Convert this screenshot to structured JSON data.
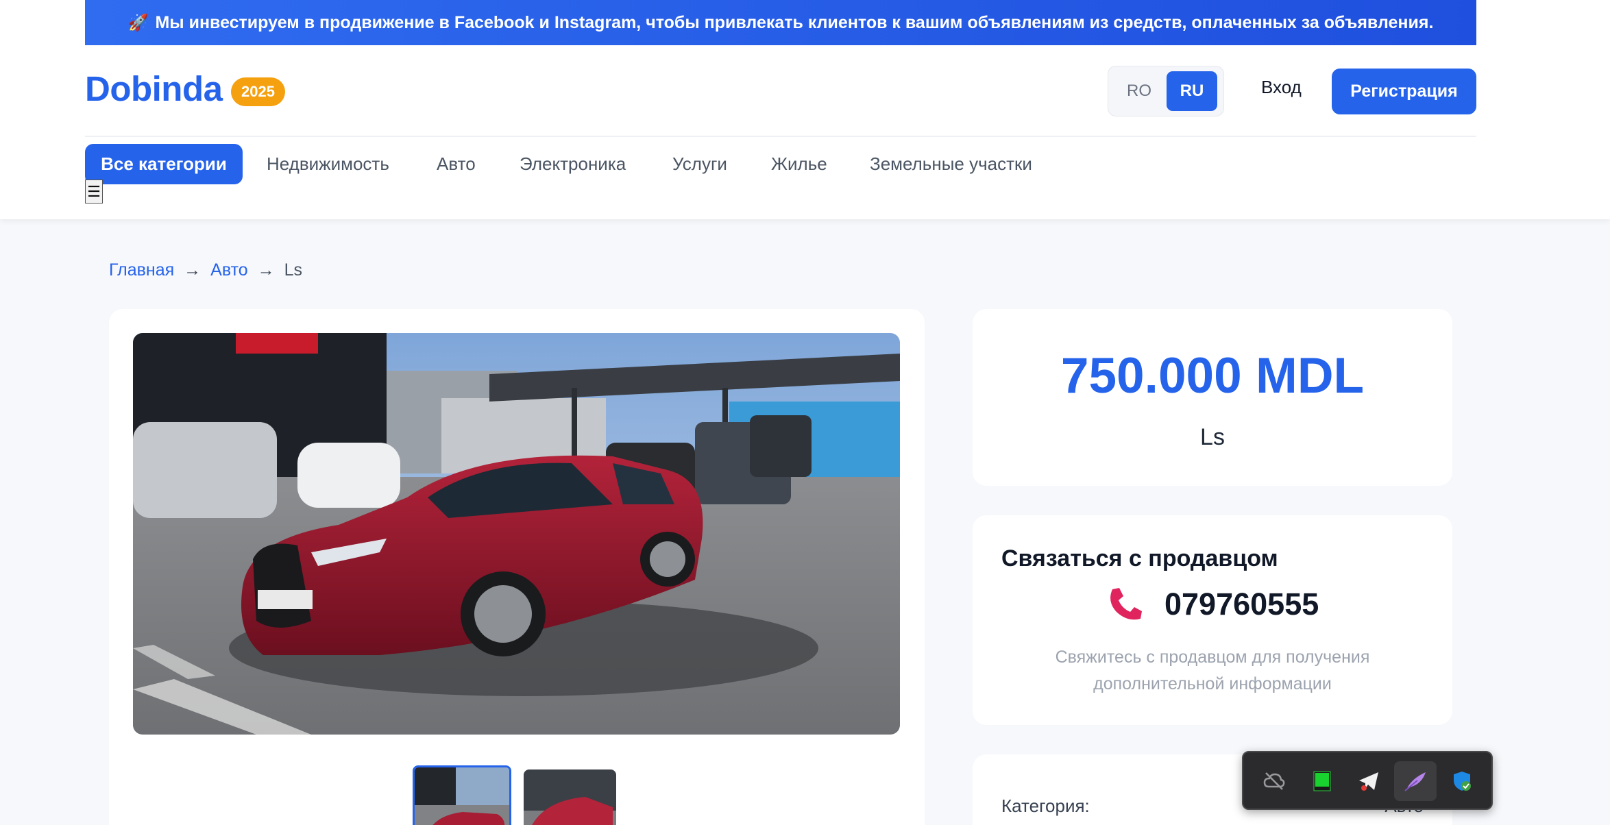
{
  "promo": {
    "icon": "rocket-icon",
    "text": "Мы инвестируем в продвижение в Facebook и Instagram, чтобы привлекать клиентов к вашим объявлениям из средств, оплаченных за объявления."
  },
  "header": {
    "logo": "Dobinda",
    "year_badge": "2025",
    "languages": [
      "RO",
      "RU"
    ],
    "active_language": "RU",
    "login": "Вход",
    "register": "Регистрация"
  },
  "categories": [
    {
      "label": "Все категории",
      "active": true
    },
    {
      "label": "Недвижимость",
      "active": false
    },
    {
      "label": "Авто",
      "active": false
    },
    {
      "label": "Электроника",
      "active": false
    },
    {
      "label": "Услуги",
      "active": false
    },
    {
      "label": "Жилье",
      "active": false
    },
    {
      "label": "Земельные участки",
      "active": false
    }
  ],
  "menu_toggle": "☰",
  "breadcrumb": {
    "items": [
      "Главная",
      "Авто",
      "Ls"
    ],
    "separator": "→"
  },
  "listing": {
    "price": "750.000 MDL",
    "model": "Ls",
    "photo_count": 2
  },
  "contact": {
    "title": "Связаться с продавцом",
    "phone": "079760555",
    "note": "Свяжитесь с продавцом для получения дополнительной информации"
  },
  "details": {
    "category_label": "Категория:",
    "category_value": "Авто"
  },
  "toolbar": {
    "buttons": [
      "cloud-off-icon",
      "green-screen-icon",
      "telegram-icon",
      "quill-icon",
      "shield-check-icon"
    ]
  },
  "colors": {
    "primary": "#2563eb",
    "badge": "#f5a00f",
    "phone_icon": "#e0245e"
  }
}
